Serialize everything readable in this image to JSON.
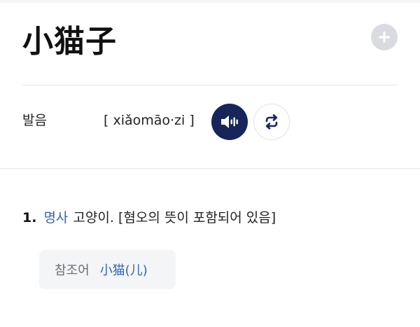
{
  "entry": {
    "headword": "小猫子"
  },
  "pronunciation": {
    "label": "발음",
    "text": "[ xiǎomāo·zi ]"
  },
  "senses": [
    {
      "number": "1.",
      "part_of_speech": "명사",
      "definition": "고양이. [혐오의 뜻이 포함되어 있음]",
      "reference_label": "참조어",
      "reference_word": "小猫(儿)"
    }
  ],
  "icons": {
    "add": "plus-icon",
    "audio": "speaker-icon",
    "repeat": "repeat-icon"
  },
  "colors": {
    "accent_navy": "#17255b",
    "link_blue": "#2f66b5",
    "add_button_gray": "#d9dbe0"
  }
}
